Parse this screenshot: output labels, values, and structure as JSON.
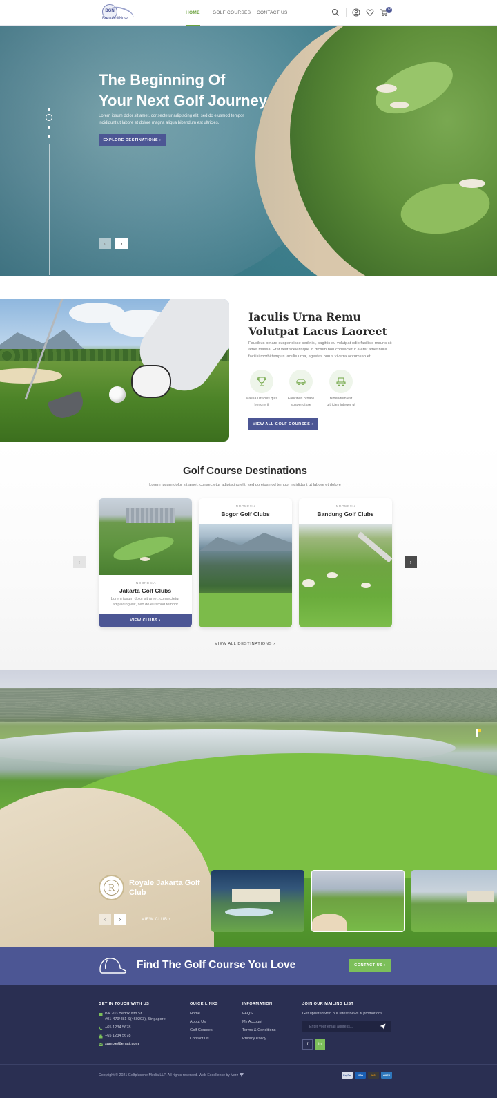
{
  "header": {
    "logo_text": "BookGolfNow",
    "logo_initials": "BGN",
    "nav": [
      "Home",
      "Golf Courses",
      "Contact Us"
    ],
    "cart_count": "12"
  },
  "hero": {
    "title_line1": "The Beginning Of",
    "title_line2": "Your Next Golf Journey",
    "subtitle": "Lorem ipsum dolor sit amet, consectetur adipiscing elit, sed do eiusmod tempor incididunt ut labore et dolore magna aliqua bibendum est ultricies.",
    "button": "Explore Destinations",
    "prev": "‹",
    "next": "›"
  },
  "about": {
    "title": "Iaculis Urna Remu Volutpat Lacus Laoreet",
    "text": "Faucibus ornare suspendisse sed nisi, sagittis eu volutpat odio facilisis mauris sit amet massa. Erat velit scelerisque in dictum non consectetur a erat amet nulla facilisi morbi tempus iaculis urna, agestas purus viverra accumsan et.",
    "features": [
      {
        "icon": "trophy-icon",
        "label": "Massa ultricies quis hendrerit"
      },
      {
        "icon": "car-icon",
        "label": "Faucibus ornare suspendisse"
      },
      {
        "icon": "golf-cart-icon",
        "label": "Bibendum est ultricies integer ut"
      }
    ],
    "button": "View All Golf Courses"
  },
  "destinations": {
    "title": "Golf Course Destinations",
    "subtitle": "Lorem ipsum dolor sit amet, consectetur adipiscing elit, sed do eiusmod tempor incididunt ut labore et dolore",
    "cards": [
      {
        "country": "Indonesia",
        "name": "Jakarta Golf Clubs",
        "desc": "Lorem ipsum dolor sit amet, consectetur adipiscing elit, sed do eiusmod tempor",
        "button": "View Clubs"
      },
      {
        "country": "Indonesia",
        "name": "Bogor Golf Clubs"
      },
      {
        "country": "Indonesia",
        "name": "Bandung Golf Clubs"
      }
    ],
    "view_all": "View All Destinations"
  },
  "club": {
    "logo_letter": "R",
    "name": "Royale Jakarta Golf Club",
    "view": "View Club"
  },
  "cta": {
    "title": "Find The Golf Course You Love",
    "button": "Contact Us"
  },
  "footer": {
    "contact_heading": "Get In Touch With Us",
    "address_line1": "Blk 203 Bedok Nth St 1",
    "address_line2": "#01-479/481 S(460203), Singapore",
    "phone1": "+65 1234 5678",
    "phone2": "+65 1234 5678",
    "email": "sample@email.com",
    "quick_heading": "Quick Links",
    "quick_links": [
      "Home",
      "About Us",
      "Golf Courses",
      "Contact Us"
    ],
    "info_heading": "Information",
    "info_links": [
      "FAQS",
      "My Account",
      "Terms & Conditions",
      "Privacy Policy"
    ],
    "mail_heading": "Join Our Mailing List",
    "mail_text": "Get updated with our latest news & promotions.",
    "mail_placeholder": "Enter your email address...",
    "social": [
      "f",
      "in"
    ],
    "copyright": "Copyright © 2021 Golfplusone Media LLP. All rights reserved. Web Excellence by Verz",
    "payments": [
      "PayPal",
      "VISA",
      "MC",
      "AMEX"
    ],
    "colors": {
      "primary": "#4c5694",
      "accent": "#7cbf5a",
      "footer": "#2a2f52"
    }
  }
}
